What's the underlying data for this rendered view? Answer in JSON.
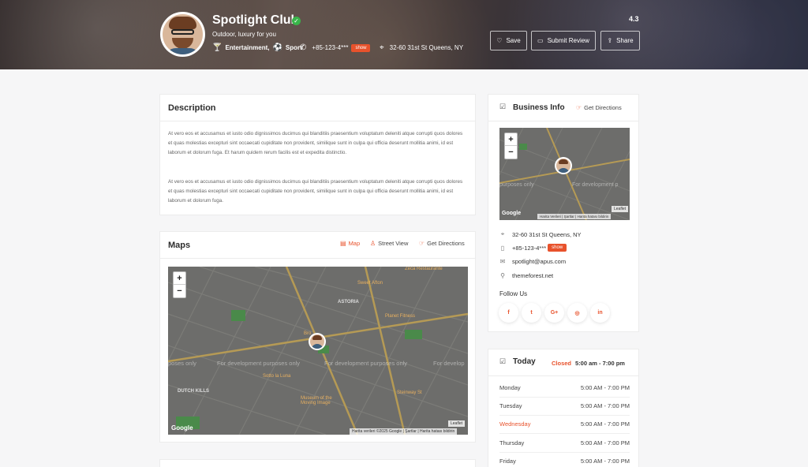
{
  "listing": {
    "title": "Spotlight Club",
    "subtitle": "Outdoor, luxury for you",
    "categories": "Entertainment,",
    "category2": "Sport",
    "phone": "+85-123-4***",
    "show_label": "show",
    "address": "32-60 31st St Queens, NY",
    "rating": "4.3"
  },
  "actions": {
    "save": "Save",
    "review": "Submit Review",
    "share": "Share"
  },
  "description": {
    "title": "Description",
    "p1": "At vero eos et accusamus et iusto odio dignissimos ducimus qui blanditiis praesentium voluptatum deleniti atque corrupti quos dolores et quas molestias excepturi sint occaecati cupiditate non provident, similique sunt in culpa qui officia deserunt mollitia animi, id est laborum et dolorum fuga. Et harum quidem rerum facilis est et expedita distinctio.",
    "p2": "At vero eos et accusamus et iusto odio dignissimos ducimus qui blanditiis praesentium voluptatum deleniti atque corrupti quos dolores et quas molestias excepturi sint occaecati cupiditate non provident, similique sunt in culpa qui officia deserunt mollitia animi, id est laborum et dolorum fuga."
  },
  "maps": {
    "title": "Maps",
    "tab_map": "Map",
    "tab_street": "Street View",
    "directions": "Get Directions",
    "zoom_in": "+",
    "zoom_out": "−",
    "dev_text": "For development purposes only",
    "dev_text_short": "poses only",
    "dev_text_tail": "For develop",
    "google": "Google",
    "attribution": "Harita verileri ©2025 Google | Şartlar | Harita hatası bildirin",
    "leaflet": "Leaflet",
    "places": [
      "Sweet Afton",
      "Zeca Restaurante",
      "ASTORIA",
      "Planet Fitness",
      "DUTCH KILLS",
      "Sotto la Luna",
      "Museum of the Moving Image",
      "Steinway St",
      "Bro"
    ]
  },
  "business": {
    "title": "Business Info",
    "directions": "Get Directions",
    "dev_left": "purposes only",
    "dev_right": "For development p",
    "attribution": "Harita Verileri | Şartlar | Harita hatası bildirin",
    "address": "32-60 31st St Queens, NY",
    "phone": "+85-123-4***",
    "show_label": "show",
    "email": "spotlight@apus.com",
    "website": "themeforest.net",
    "follow": "Follow Us",
    "socials": [
      "f",
      "t",
      "G+",
      "◎",
      "in"
    ]
  },
  "hours": {
    "title": "Today",
    "status": "Closed",
    "today": "5:00 am - 7:00 pm",
    "rows": [
      {
        "day": "Monday",
        "time": "5:00 AM - 7:00 PM"
      },
      {
        "day": "Tuesday",
        "time": "5:00 AM - 7:00 PM"
      },
      {
        "day": "Wednesday",
        "time": "5:00 AM - 7:00 PM"
      },
      {
        "day": "Thursday",
        "time": "5:00 AM - 7:00 PM"
      },
      {
        "day": "Friday",
        "time": "5:00 AM - 7:00 PM"
      }
    ]
  },
  "colors": {
    "accent": "#e8522c",
    "verified": "#39b54a"
  }
}
